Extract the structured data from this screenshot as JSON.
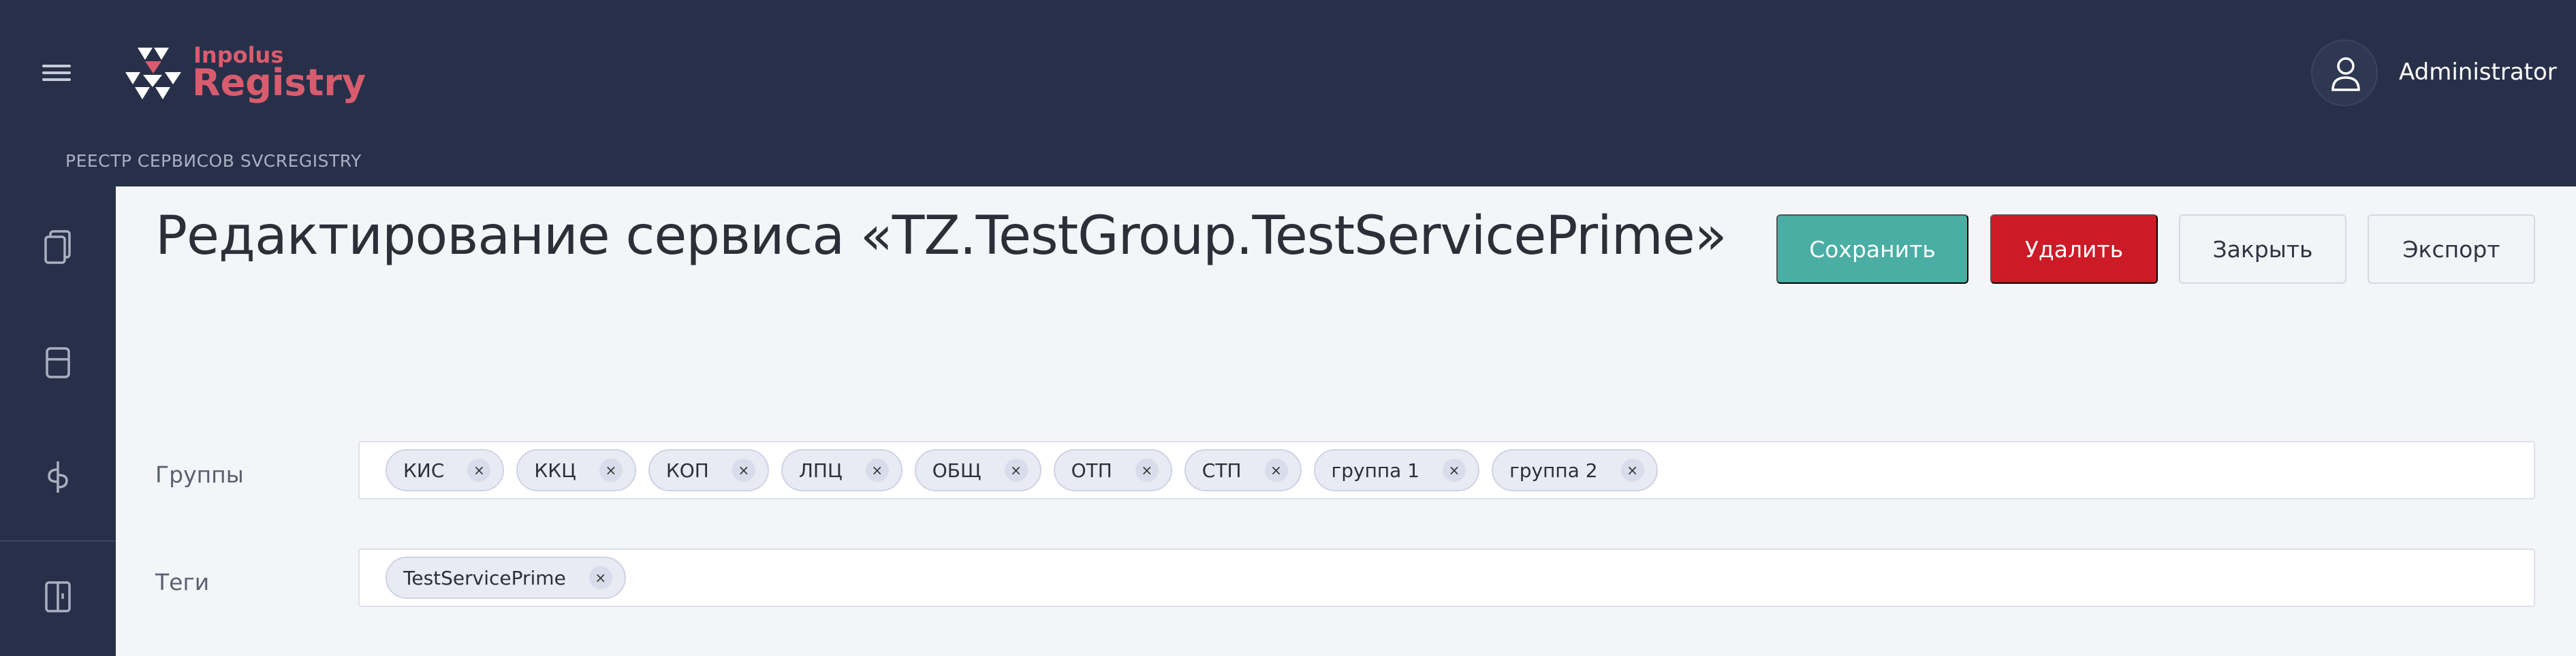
{
  "app": {
    "logo_small": "Inpolus",
    "logo_big": "Registry",
    "breadcrumb": "РЕЕСТР СЕРВИСОВ SVCREGISTRY",
    "username": "Administrator"
  },
  "sidebar": {
    "icons": [
      "documents-icon",
      "panel-icon",
      "fork-icon",
      "logout-icon"
    ]
  },
  "page": {
    "title": "Редактирование сервиса «TZ.TestGroup.TestServicePrime»"
  },
  "toolbar": {
    "save_label": "Сохранить",
    "delete_label": "Удалить",
    "close_label": "Закрыть",
    "export_label": "Экспорт"
  },
  "fields": {
    "groups": {
      "label": "Группы",
      "chips": [
        "КИС",
        "ККЦ",
        "КОП",
        "ЛПЦ",
        "ОБЩ",
        "ОТП",
        "СТП",
        "группа 1",
        "группа 2"
      ],
      "remove_glyph": "×"
    },
    "tags": {
      "label": "Теги",
      "chips": [
        "TestServicePrime"
      ],
      "remove_glyph": "×"
    }
  },
  "colors": {
    "header_bg": "#283049",
    "brand": "#d95c6e",
    "save": "#4aaea4",
    "delete": "#cc1a26"
  }
}
